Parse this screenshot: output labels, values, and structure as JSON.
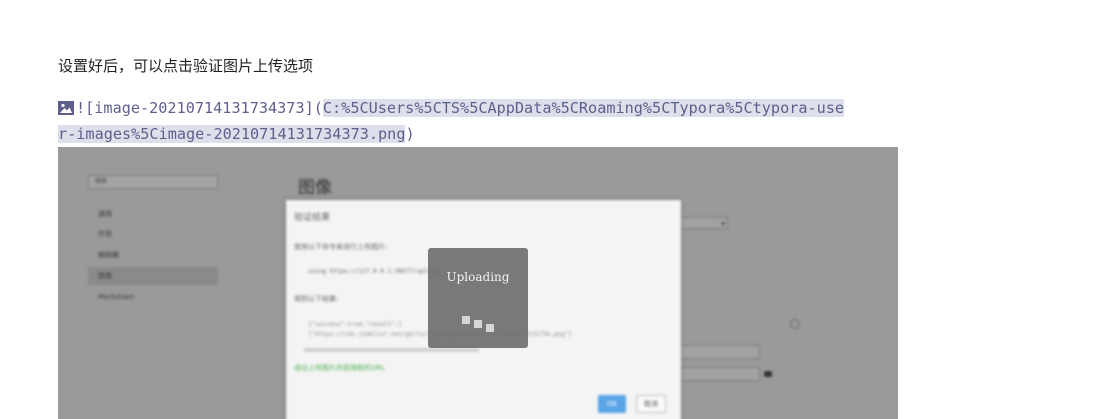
{
  "paragraph": "设置好后，可以点击验证图片上传选项",
  "markdown": {
    "icon": "image-icon",
    "line1_plain": "![image-20210714131734373](",
    "line1_selected": "C:%5CUsers%5CTS%5CAppData%5CRoaming%5CTypora%5Ctypora-use",
    "line2_selected": "r-images%5Cimage-20210714131734373.png",
    "line2_plain": ")"
  },
  "screenshot": {
    "page_title": "图像",
    "search_placeholder": "搜索",
    "nav_items": [
      "通用",
      "外观",
      "编辑器",
      "图像",
      "Markdown"
    ],
    "active_nav": 3,
    "select_value": "▾",
    "dialog": {
      "title": "验证结果",
      "line1": "使用以下命令来进行上传图片:",
      "line2": "using https://127.0.0.1:36677/upload",
      "line3": "得到以下结果:",
      "line4a": "{\"success\":true,\"result\":[",
      "line4b": "[\"https://cdn.jsdelivr.net/gh/ts/typora@main/article/20210714131734.png\"]",
      "line5": "成功上传图片并获得新的URL",
      "ok_label": "OK",
      "cancel_label": "取消"
    }
  },
  "overlay": {
    "label": "Uploading"
  }
}
